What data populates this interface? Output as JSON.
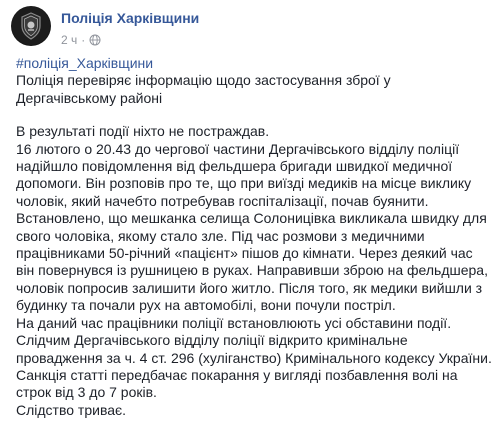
{
  "post": {
    "page_name": "Поліція Харківщини",
    "timestamp": "2 ч",
    "privacy_icon": "globe-icon",
    "avatar_icon": "police-badge-icon",
    "hashtag": "#поліція_Харківщини",
    "title_lines": [
      "Поліція перевіряє інформацію щодо застосування зброї у",
      "Дергачівському районі"
    ],
    "body_lines": [
      "В результаті події ніхто не постраждав.",
      "16 лютого о 20.43 до чергової частини Дергачівського відділу поліції",
      "надійшло повідомлення від фельдшера бригади швидкої медичної",
      "допомоги. Він розповів про те, що при виїзді медиків на місце виклику",
      "чоловік, який начебто потребував госпіталізації, почав буянити.",
      "Встановлено, що мешканка селища Солоницівка викликала швидку для",
      "свого чоловіка, якому стало зле. Під час розмови з медичними",
      "працівниками 50-річний «пацієнт» пішов до кімнати. Через деякий час",
      "він повернувся із рушницею в руках. Направивши зброю на фельдшера,",
      "чоловік попросив залишити його житло. Після того, як медики вийшли з",
      "будинку та почали рух на автомобілі, вони почули постріл.",
      "На даний час працівники поліції встановлюють усі обставини події.",
      "Слідчим Дергачівського відділу поліції відкрито кримінальне",
      "провадження за ч. 4 ст. 296 (хуліганство) Кримінального кодексу України.",
      "Санкція статті передбачає покарання у вигляді позбавлення волі на",
      "строк від 3 до 7 років.",
      "Слідство триває."
    ]
  },
  "colors": {
    "link": "#365899",
    "text": "#1d2129",
    "meta": "#90949c"
  }
}
